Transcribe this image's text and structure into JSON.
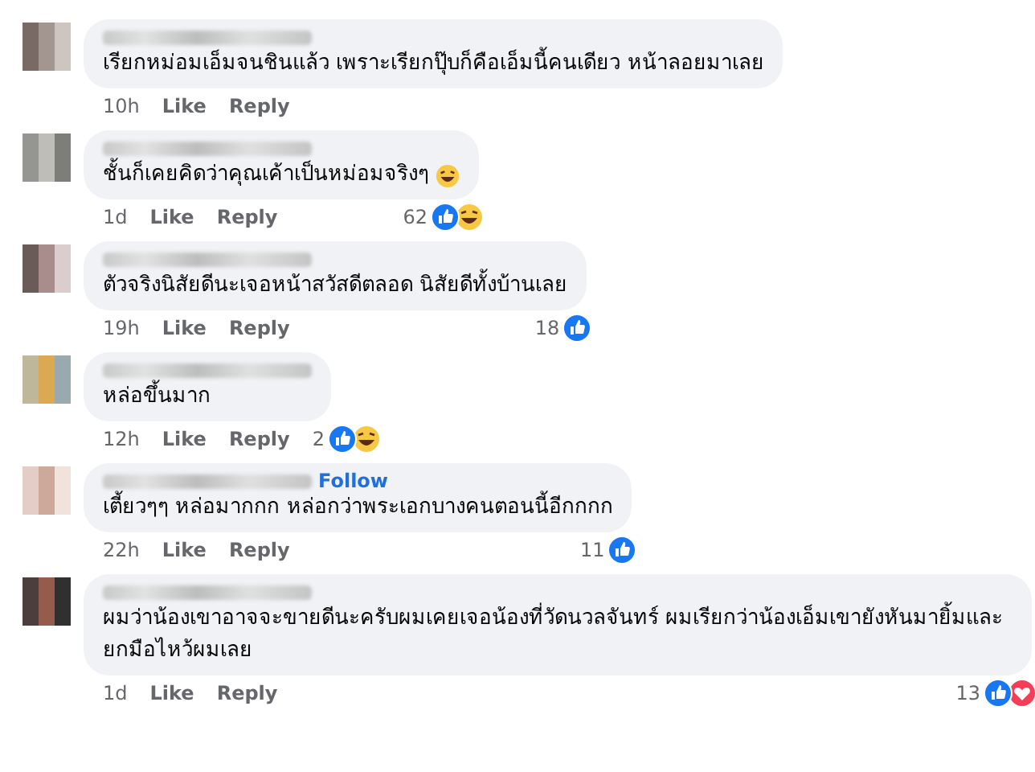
{
  "comments": [
    {
      "text": "เรียกหม่อมเอ็มจนชินแล้ว เพราะเรียกปุ๊บก็คือเอ็มนี้คนเดียว หน้าลอยมาเลย",
      "laughing_emoji": false,
      "time": "10h",
      "like": "Like",
      "reply": "Reply"
    },
    {
      "text": "ชั้นก็เคยคิดว่าคุณเค้าเป็นหม่อมจริงๆ",
      "laughing_emoji": true,
      "time": "1d",
      "like": "Like",
      "reply": "Reply",
      "reaction_count": "62",
      "reactions": [
        {
          "kind": "like"
        },
        {
          "kind": "haha"
        }
      ]
    },
    {
      "text": "ตัวจริงนิสัยดีนะเจอหน้าสวัสดีตลอด นิสัยดีทั้งบ้านเลย",
      "laughing_emoji": false,
      "time": "19h",
      "like": "Like",
      "reply": "Reply",
      "reaction_count": "18",
      "reactions": [
        {
          "kind": "like"
        }
      ]
    },
    {
      "text": "หล่อขึ้นมาก",
      "laughing_emoji": false,
      "time": "12h",
      "like": "Like",
      "reply": "Reply",
      "reaction_count": "2",
      "reactions": [
        {
          "kind": "like"
        },
        {
          "kind": "haha"
        }
      ]
    },
    {
      "text": "เตี้ยวๆๆ หล่อมากกก หล่อกว่าพระเอกบางคนตอนนี้อีกกกก",
      "laughing_emoji": false,
      "follow": "Follow",
      "time": "22h",
      "like": "Like",
      "reply": "Reply",
      "reaction_count": "11",
      "reactions": [
        {
          "kind": "like"
        }
      ]
    },
    {
      "text": "ผมว่าน้องเขาอาจจะขายดีนะครับผมเคยเจอน้องที่วัดนวลจันทร์ ผมเรียกว่าน้องเอ็มเขายังหันมายิ้มและยกมือไหว้ผมเลย",
      "laughing_emoji": false,
      "time": "1d",
      "like": "Like",
      "reply": "Reply",
      "reaction_count": "13",
      "reactions": [
        {
          "kind": "like"
        },
        {
          "kind": "love"
        }
      ]
    }
  ]
}
